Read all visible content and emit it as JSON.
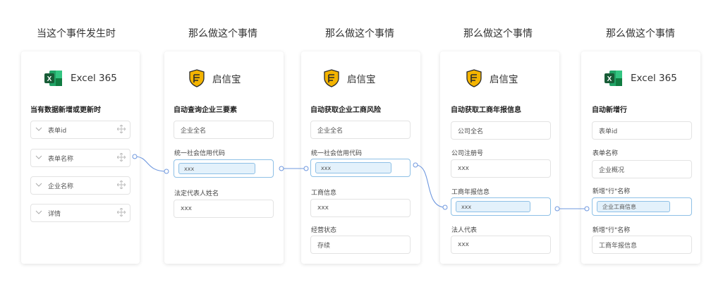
{
  "columns": [
    {
      "header": "当这个事件发生时"
    },
    {
      "header": "那么做这个事情"
    },
    {
      "header": "那么做这个事情"
    },
    {
      "header": "那么做这个事情"
    },
    {
      "header": "那么做这个事情"
    }
  ],
  "cards": [
    {
      "app": "Excel 365",
      "title": "当有数据新增或更新时",
      "fields": [
        "表单id",
        "表单名称",
        "企业名称",
        "详情"
      ]
    },
    {
      "app": "启信宝",
      "title": "自动查询企业三要素",
      "input1": "企业全名",
      "label2": "统一社会信用代码",
      "chip2": "xxx",
      "label3": "法定代表人姓名",
      "input3": "xxx"
    },
    {
      "app": "启信宝",
      "title": "自动获取企业工商风险",
      "input1": "企业全名",
      "label2": "统一社会信用代码",
      "chip2": "xxx",
      "label3": "工商信息",
      "input3": "xxx",
      "label4": "经营状态",
      "input4": "存续"
    },
    {
      "app": "启信宝",
      "title": "自动获取工商年报信息",
      "input1": "公司全名",
      "label2": "公司注册号",
      "input2": "xxx",
      "label3": "工商年报信息",
      "chip3": "xxx",
      "label4": "法人代表",
      "input4": "xxx"
    },
    {
      "app": "Excel 365",
      "title": "自动新增行",
      "input1": "表单id",
      "label2": "表单名称",
      "input2": "企业概况",
      "label3": "新增\"行\"名称",
      "chip3": "企业工商信息",
      "label4": "新增\"行\"名称",
      "input4": "工商年报信息"
    }
  ],
  "colors": {
    "connector": "#6f98df",
    "chip_border": "#8ec0e6",
    "chip_bg": "#e3f1fb",
    "excel": "#1e7145",
    "qxb_gold": "#f4b400"
  },
  "icons": [
    "excel-icon",
    "qixinbao-shield-icon",
    "chevron-down-icon",
    "move-icon"
  ]
}
